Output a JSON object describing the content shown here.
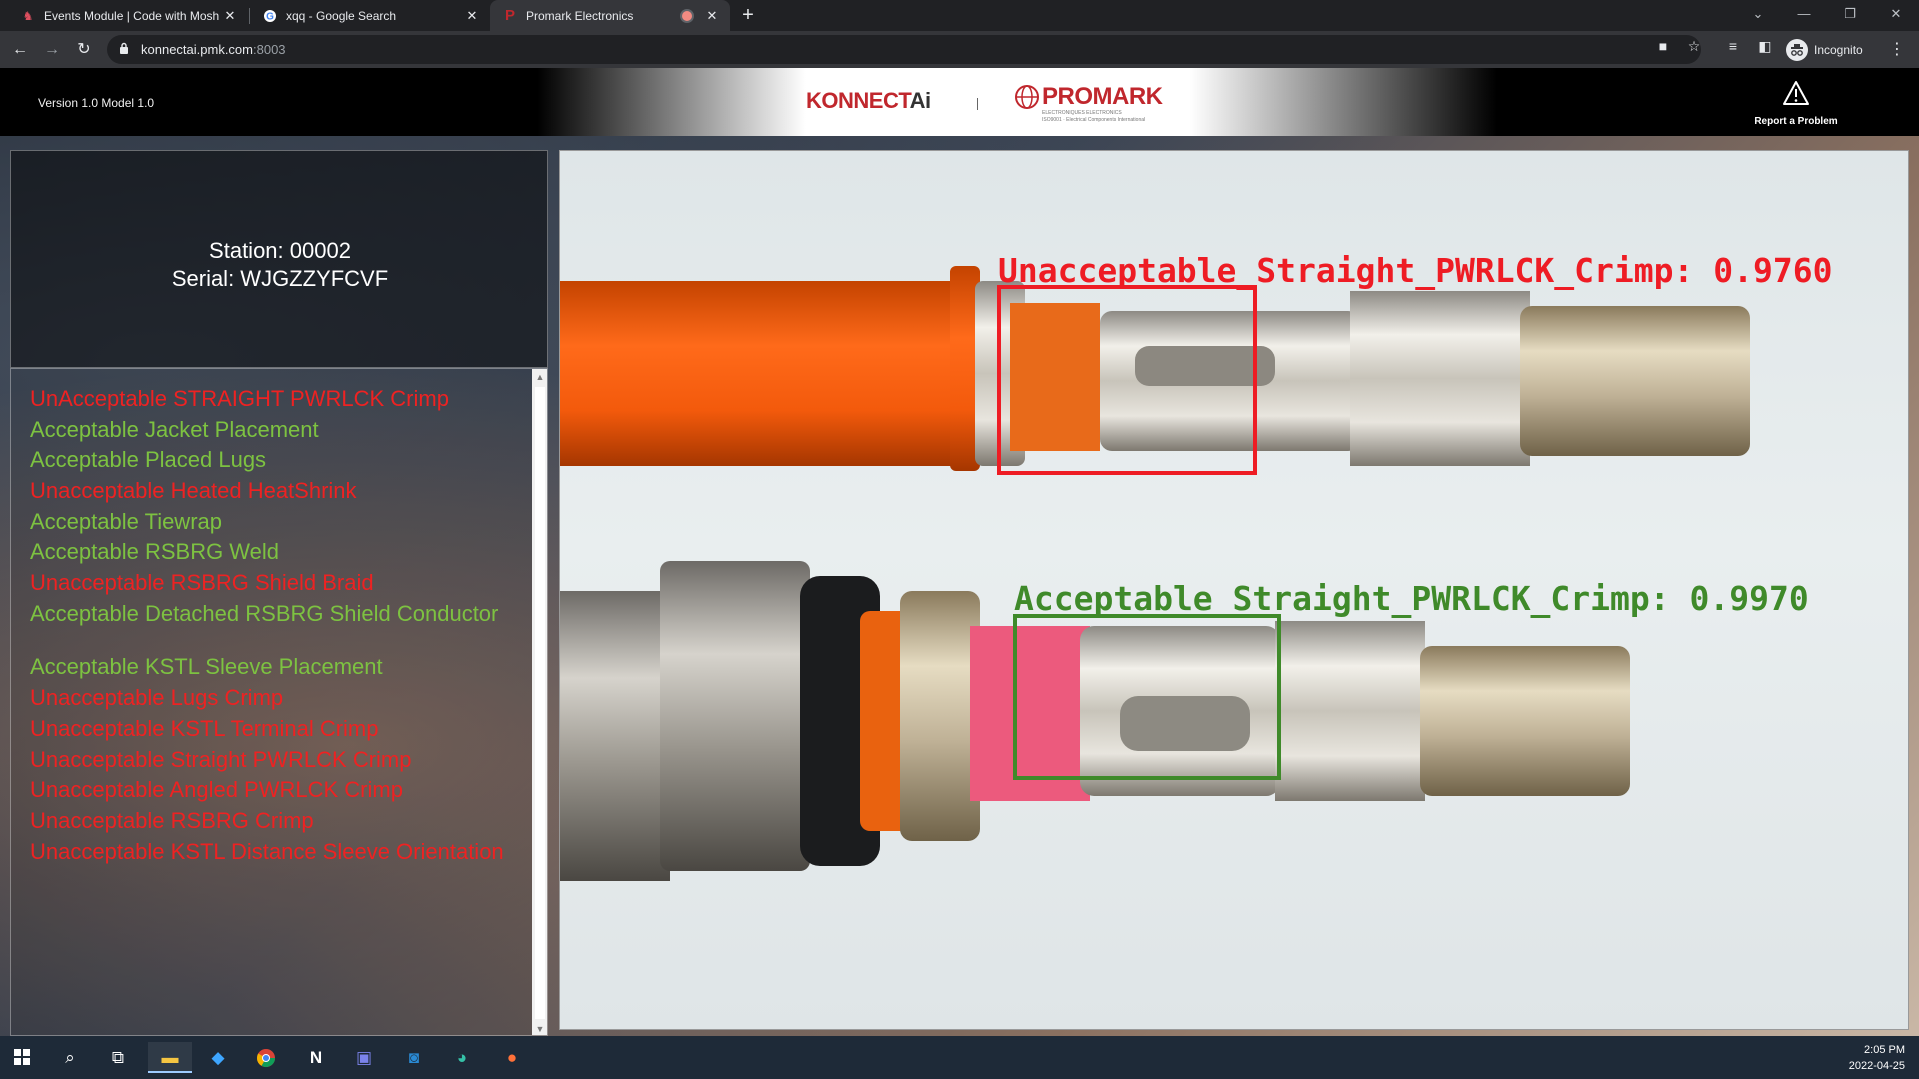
{
  "browser": {
    "tabs": [
      {
        "title": "Events Module | Code with Mosh",
        "favicon_color": "#e04f5f"
      },
      {
        "title": "xqq - Google Search",
        "favicon_color": "#ffffff"
      },
      {
        "title": "Promark Electronics",
        "favicon_color": "#c0272d",
        "active": true
      }
    ],
    "url_host": "konnectai.pmk.com",
    "url_port": ":8003",
    "profile_label": "Incognito"
  },
  "header": {
    "version_text": "Version 1.0 Model 1.0",
    "logo_konnect": "KONNECT",
    "logo_ai": "Ai",
    "logo_promark": "PROMARK",
    "logo_promark_sub1": "ELECTRONIQUES ELECTRONICS",
    "logo_promark_sub2": "ISO9001 · Electrical Components International",
    "report_label": "Report a Problem"
  },
  "station": {
    "station_text": "Station: 00002",
    "serial_text": "Serial: WJGZZYFCVF"
  },
  "colors": {
    "fail": "#ee2222",
    "pass": "#7dc241",
    "box_fail": "#ee1c24",
    "box_pass": "#3f8a2a"
  },
  "results": [
    {
      "text": "UnAcceptable STRAIGHT PWRLCK Crimp",
      "status": "fail"
    },
    {
      "text": "Acceptable Jacket Placement",
      "status": "pass"
    },
    {
      "text": "Acceptable Placed Lugs",
      "status": "pass"
    },
    {
      "text": "Unacceptable Heated HeatShrink",
      "status": "fail"
    },
    {
      "text": "Acceptable Tiewrap",
      "status": "pass"
    },
    {
      "text": "Acceptable RSBRG Weld",
      "status": "pass"
    },
    {
      "text": "Unacceptable RSBRG Shield Braid",
      "status": "fail"
    },
    {
      "text": "Acceptable Detached RSBRG Shield Conductor",
      "status": "pass"
    },
    {
      "text": "Acceptable KSTL Sleeve Placement",
      "status": "pass"
    },
    {
      "text": "Unacceptable Lugs Crimp",
      "status": "fail"
    },
    {
      "text": "Unacceptable KSTL Terminal Crimp",
      "status": "fail"
    },
    {
      "text": "Unacceptable Straight PWRLCK Crimp",
      "status": "fail"
    },
    {
      "text": "Unacceptable Angled PWRLCK Crimp",
      "status": "fail"
    },
    {
      "text": "Unacceptable RSBRG Crimp",
      "status": "fail"
    },
    {
      "text": "Unacceptable KSTL Distance Sleeve Orientation",
      "status": "fail"
    }
  ],
  "detections": [
    {
      "label": "Unacceptable_Straight_PWRLCK_Crimp: 0.9760",
      "status": "fail"
    },
    {
      "label": "Acceptable_Straight_PWRLCK_Crimp: 0.9970",
      "status": "pass"
    }
  ],
  "taskbar": {
    "icons": [
      "windows-start",
      "search",
      "task-view",
      "file-explorer",
      "vscode",
      "chrome",
      "notion",
      "teams",
      "outlook",
      "edge",
      "firefox"
    ],
    "time": "2:05 PM",
    "date": "2022-04-25"
  }
}
